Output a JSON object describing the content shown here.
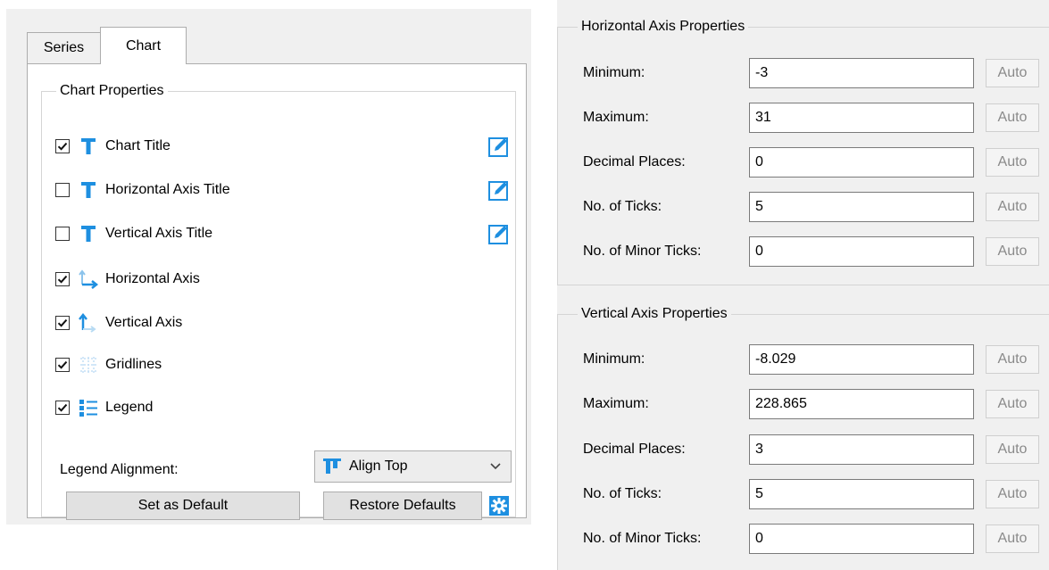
{
  "tabs": [
    {
      "label": "Series"
    },
    {
      "label": "Chart"
    }
  ],
  "chart_properties": {
    "title": "Chart Properties",
    "items": [
      {
        "label": "Chart Title",
        "checked": true,
        "icon": "title-t-icon",
        "editable": true
      },
      {
        "label": "Horizontal Axis Title",
        "checked": false,
        "icon": "title-t-icon",
        "editable": true
      },
      {
        "label": "Vertical Axis Title",
        "checked": false,
        "icon": "title-t-icon",
        "editable": true
      },
      {
        "label": "Horizontal Axis",
        "checked": true,
        "icon": "horizontal-axis-icon",
        "editable": false
      },
      {
        "label": "Vertical Axis",
        "checked": true,
        "icon": "vertical-axis-icon",
        "editable": false
      },
      {
        "label": "Gridlines",
        "checked": true,
        "icon": "gridlines-icon",
        "editable": false
      },
      {
        "label": "Legend",
        "checked": true,
        "icon": "legend-icon",
        "editable": false
      }
    ],
    "legend_alignment_label": "Legend Alignment:",
    "legend_alignment_value": "Align Top",
    "set_default_label": "Set as Default",
    "restore_defaults_label": "Restore Defaults"
  },
  "horizontal_axis": {
    "title": "Horizontal Axis Properties",
    "fields": [
      {
        "label": "Minimum:",
        "value": "-3",
        "auto": "Auto"
      },
      {
        "label": "Maximum:",
        "value": "31",
        "auto": "Auto"
      },
      {
        "label": "Decimal Places:",
        "value": "0",
        "auto": "Auto"
      },
      {
        "label": "No. of Ticks:",
        "value": "5",
        "auto": "Auto"
      },
      {
        "label": "No. of Minor Ticks:",
        "value": "0",
        "auto": "Auto"
      }
    ]
  },
  "vertical_axis": {
    "title": "Vertical Axis Properties",
    "fields": [
      {
        "label": "Minimum:",
        "value": "-8.029",
        "auto": "Auto"
      },
      {
        "label": "Maximum:",
        "value": "228.865",
        "auto": "Auto"
      },
      {
        "label": "Decimal Places:",
        "value": "3",
        "auto": "Auto"
      },
      {
        "label": "No. of Ticks:",
        "value": "5",
        "auto": "Auto"
      },
      {
        "label": "No. of Minor Ticks:",
        "value": "0",
        "auto": "Auto"
      }
    ]
  },
  "colors": {
    "accent": "#1e8fe0",
    "panel_bg": "#f0f0f0"
  }
}
